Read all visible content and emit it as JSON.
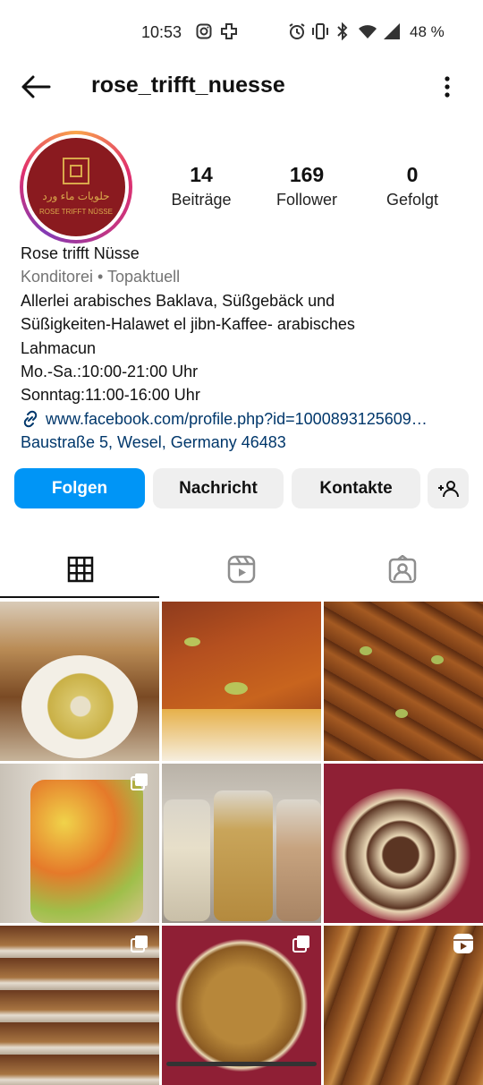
{
  "status_bar": {
    "time": "10:53",
    "battery": "48 %",
    "icons": [
      "instagram-icon",
      "medical-icon",
      "alarm-icon",
      "vibrate-icon",
      "bluetooth-icon",
      "wifi-icon",
      "signal-icon"
    ]
  },
  "header": {
    "username": "rose_trifft_nuesse",
    "back_icon": "arrow-left-icon",
    "menu_icon": "more-vertical-icon"
  },
  "profile": {
    "avatar_text_arabic": "حلويات ماء ورد",
    "avatar_text_latin": "ROSE TRIFFT NÜSSE",
    "stats": [
      {
        "value": "14",
        "label": "Beiträge"
      },
      {
        "value": "169",
        "label": "Follower"
      },
      {
        "value": "0",
        "label": "Gefolgt"
      }
    ],
    "name": "Rose trifft Nüsse",
    "category": "Konditorei • Topaktuell",
    "bio_lines": [
      "Allerlei arabisches Baklava, Süßgebäck und",
      "Süßigkeiten-Halawet el jibn-Kaffee- arabisches",
      "Lahmacun",
      "Mo.-Sa.:10:00-21:00 Uhr",
      "Sonntag:11:00-16:00 Uhr"
    ],
    "link": "www.facebook.com/profile.php?id=1000893125609…",
    "address": "Baustraße 5, Wesel, Germany 46483"
  },
  "actions": {
    "follow": "Folgen",
    "message": "Nachricht",
    "contacts": "Kontakte",
    "add_user_icon": "add-person-icon"
  },
  "tabs": [
    "grid-icon",
    "reels-icon",
    "tagged-icon"
  ],
  "colors": {
    "accent": "#0095f6",
    "button_bg": "#efefef",
    "link": "#00376b",
    "secondary_text": "#737373"
  },
  "grid": [
    {
      "subject": "syrian sweets tray",
      "badge": ""
    },
    {
      "subject": "kunafa",
      "badge": ""
    },
    {
      "subject": "baklava pistachio",
      "badge": ""
    },
    {
      "subject": "jar of mixed snacks",
      "badge": "multi"
    },
    {
      "subject": "jars of seeds",
      "badge": ""
    },
    {
      "subject": "meat pastries",
      "badge": ""
    },
    {
      "subject": "pastry display",
      "badge": "multi"
    },
    {
      "subject": "lahmacun",
      "badge": "multi"
    },
    {
      "subject": "baklava rolls",
      "badge": "reel"
    }
  ]
}
